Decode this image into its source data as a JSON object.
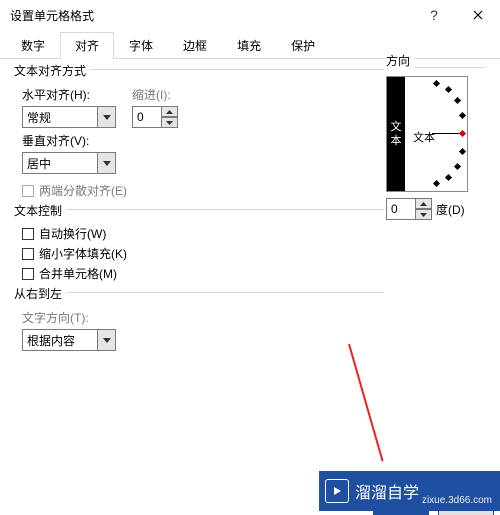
{
  "window": {
    "title": "设置单元格格式"
  },
  "tabs": [
    "数字",
    "对齐",
    "字体",
    "边框",
    "填充",
    "保护"
  ],
  "active_tab_index": 1,
  "alignment": {
    "group_label": "文本对齐方式",
    "horizontal": {
      "label": "水平对齐(H):",
      "value": "常规"
    },
    "vertical": {
      "label": "垂直对齐(V):",
      "value": "居中"
    },
    "indent": {
      "label": "缩进(I):",
      "value": "0"
    },
    "justify_distributed": "两端分散对齐(E)"
  },
  "text_control": {
    "group_label": "文本控制",
    "wrap": "自动换行(W)",
    "shrink": "缩小字体填充(K)",
    "merge": "合并单元格(M)"
  },
  "rtl": {
    "group_label": "从右到左",
    "direction_label": "文字方向(T):",
    "direction_value": "根据内容"
  },
  "orientation": {
    "group_label": "方向",
    "vertical_text": "文本",
    "center_label": "文本",
    "degrees_value": "0",
    "degrees_label": "度(D)"
  },
  "watermark": {
    "brand": "溜溜自学",
    "sub": "zixue.3d66.com"
  }
}
